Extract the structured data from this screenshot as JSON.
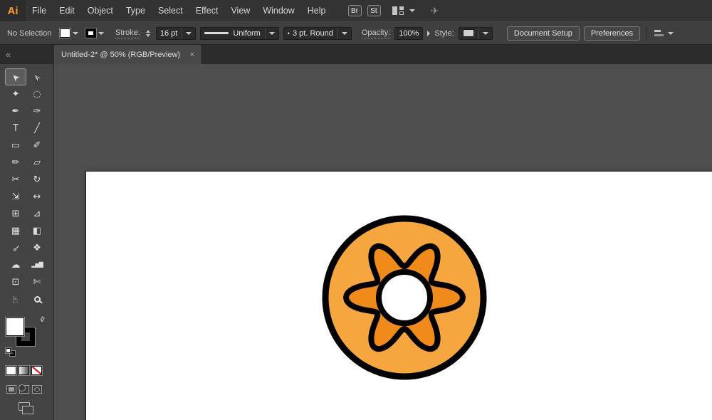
{
  "menubar": {
    "logo": "Ai",
    "items": [
      "File",
      "Edit",
      "Object",
      "Type",
      "Select",
      "Effect",
      "View",
      "Window",
      "Help"
    ],
    "bridge_label": "Br",
    "stock_label": "St",
    "gpu_glyph": "✈"
  },
  "control_bar": {
    "selection_status": "No Selection",
    "stroke_label": "Stroke:",
    "stroke_weight": "16 pt",
    "width_profile": "Uniform",
    "brush_bullet": "•",
    "brush": "3 pt. Round",
    "opacity_label": "Opacity:",
    "opacity_value": "100%",
    "style_label": "Style:",
    "document_setup_label": "Document Setup",
    "preferences_label": "Preferences"
  },
  "tab_bar": {
    "collapse_glyph": "«",
    "tab_title": "Untitled-2* @ 50% (RGB/Preview)",
    "close_glyph": "×"
  },
  "toolbar": {
    "swap_glyph": "⇄",
    "tools": [
      {
        "name": "selection",
        "glyph": "➤",
        "rot": -135,
        "active": true
      },
      {
        "name": "direct-selection",
        "glyph": "➣",
        "rot": -135
      },
      {
        "name": "magic-wand",
        "glyph": "✦"
      },
      {
        "name": "lasso",
        "glyph": "◌"
      },
      {
        "name": "pen",
        "glyph": "✒"
      },
      {
        "name": "curvature",
        "glyph": "✑"
      },
      {
        "name": "type",
        "glyph": "T"
      },
      {
        "name": "line-segment",
        "glyph": "╱"
      },
      {
        "name": "rectangle",
        "glyph": "▭"
      },
      {
        "name": "paintbrush",
        "glyph": "✐"
      },
      {
        "name": "pencil",
        "glyph": "✏"
      },
      {
        "name": "eraser",
        "glyph": "▱"
      },
      {
        "name": "scissors",
        "glyph": "✂"
      },
      {
        "name": "rotate",
        "glyph": "↻"
      },
      {
        "name": "scale",
        "glyph": "⇲"
      },
      {
        "name": "width",
        "glyph": "↔"
      },
      {
        "name": "free-transform",
        "glyph": "⊞"
      },
      {
        "name": "perspective-grid",
        "glyph": "⊿"
      },
      {
        "name": "mesh",
        "glyph": "▦"
      },
      {
        "name": "gradient",
        "glyph": "◧"
      },
      {
        "name": "eyedropper",
        "glyph": "⊸",
        "rot": 135
      },
      {
        "name": "blend",
        "glyph": "❖"
      },
      {
        "name": "symbol-sprayer",
        "glyph": "☁"
      },
      {
        "name": "column-graph",
        "glyph": "▂▅▇",
        "small": true
      },
      {
        "name": "artboard",
        "glyph": "⊡"
      },
      {
        "name": "slice",
        "glyph": "✄"
      },
      {
        "name": "hand",
        "glyph": "☞",
        "rot": -90
      },
      {
        "name": "zoom",
        "css": "zoom"
      }
    ]
  },
  "canvas": {
    "donut": {
      "outer_fill": "#F6A63E",
      "gear_fill": "#F08B1B",
      "hole_fill": "#FFFFFF",
      "outline": "#000000",
      "gear": {
        "lobes": 6,
        "r_base": 63,
        "r_amp": 19
      }
    }
  }
}
